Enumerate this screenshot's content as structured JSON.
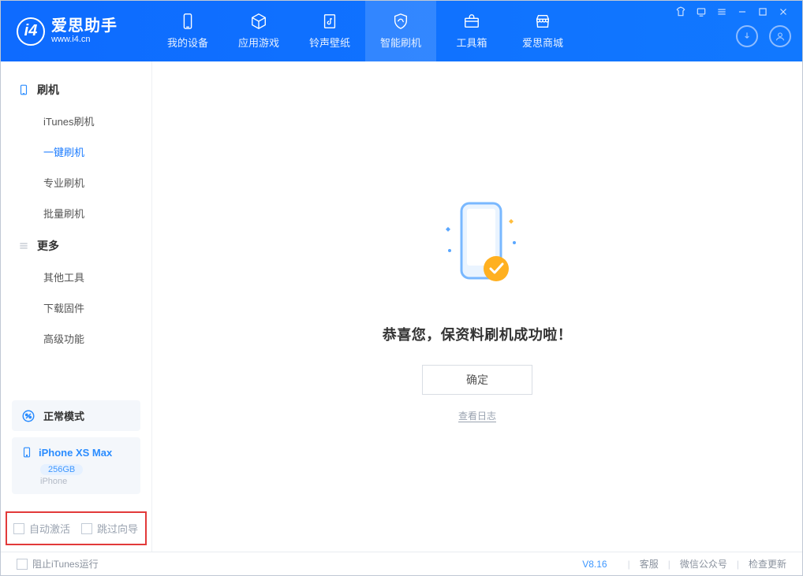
{
  "app": {
    "title": "爱思助手",
    "subtitle": "www.i4.cn"
  },
  "tabs": [
    {
      "label": "我的设备"
    },
    {
      "label": "应用游戏"
    },
    {
      "label": "铃声壁纸"
    },
    {
      "label": "智能刷机"
    },
    {
      "label": "工具箱"
    },
    {
      "label": "爱思商城"
    }
  ],
  "sidebar": {
    "section1": {
      "title": "刷机",
      "items": [
        {
          "label": "iTunes刷机"
        },
        {
          "label": "一键刷机"
        },
        {
          "label": "专业刷机"
        },
        {
          "label": "批量刷机"
        }
      ]
    },
    "section2": {
      "title": "更多",
      "items": [
        {
          "label": "其他工具"
        },
        {
          "label": "下载固件"
        },
        {
          "label": "高级功能"
        }
      ]
    }
  },
  "device": {
    "mode": "正常模式",
    "name": "iPhone XS Max",
    "storage": "256GB",
    "platform": "iPhone"
  },
  "flags": {
    "auto_activate": "自动激活",
    "skip_guide": "跳过向导"
  },
  "content": {
    "success_text": "恭喜您，保资料刷机成功啦！",
    "ok_button": "确定",
    "view_log": "查看日志"
  },
  "status": {
    "block_itunes": "阻止iTunes运行",
    "version": "V8.16",
    "support": "客服",
    "wechat": "微信公众号",
    "check_update": "检查更新"
  }
}
